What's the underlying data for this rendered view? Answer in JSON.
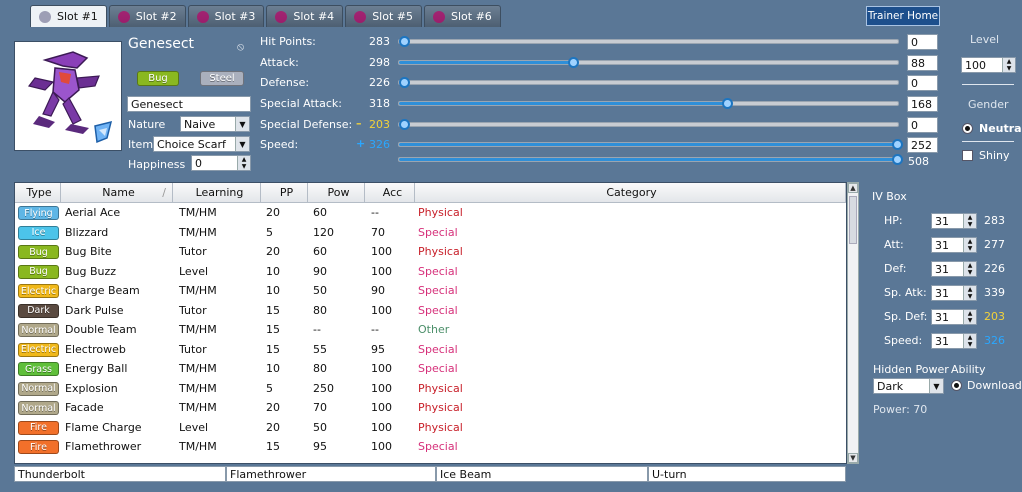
{
  "colors": {
    "background": "#5a7796",
    "slider": "#2f8fd8",
    "stat_up": "#2aa7ff",
    "stat_down": "#f2d23a",
    "physical": "#c8202a",
    "special": "#d6307a",
    "other": "#4c8f6a"
  },
  "tabs": [
    {
      "label": "Slot #1",
      "icon": "genesect-icon",
      "active": true
    },
    {
      "label": "Slot #2",
      "icon": "pokemon-icon",
      "active": false
    },
    {
      "label": "Slot #3",
      "icon": "pokemon-icon",
      "active": false
    },
    {
      "label": "Slot #4",
      "icon": "pokemon-icon",
      "active": false
    },
    {
      "label": "Slot #5",
      "icon": "pokemon-icon",
      "active": false
    },
    {
      "label": "Slot #6",
      "icon": "pokemon-icon",
      "active": false
    }
  ],
  "trainer_home": "Trainer Home",
  "pokemon": {
    "species": "Genesect",
    "gender_symbol": "⦸",
    "types": [
      {
        "name": "Bug",
        "color": "#8ab820"
      },
      {
        "name": "Steel",
        "color": "#aab0bd"
      }
    ],
    "nickname": "Genesect",
    "nature_label": "Nature",
    "nature": "Naive",
    "item_label": "Item",
    "item": "Choice Scarf",
    "happiness_label": "Happiness",
    "happiness": "0"
  },
  "stats": [
    {
      "label": "Hit Points:",
      "value": "283",
      "ev": "0",
      "ev_fraction": 0.0,
      "modifier": "",
      "value_color": "#ffffff"
    },
    {
      "label": "Attack:",
      "value": "298",
      "ev": "88",
      "ev_fraction": 0.35,
      "modifier": "",
      "value_color": "#ffffff"
    },
    {
      "label": "Defense:",
      "value": "226",
      "ev": "0",
      "ev_fraction": 0.0,
      "modifier": "",
      "value_color": "#ffffff"
    },
    {
      "label": "Special Attack:",
      "value": "318",
      "ev": "168",
      "ev_fraction": 0.66,
      "modifier": "",
      "value_color": "#ffffff"
    },
    {
      "label": "Special Defense:",
      "value": "203",
      "ev": "0",
      "ev_fraction": 0.0,
      "modifier": "–",
      "value_color": "#f2d23a"
    },
    {
      "label": "Speed:",
      "value": "326",
      "ev": "252",
      "ev_fraction": 1.0,
      "modifier": "+",
      "value_color": "#2aa7ff"
    }
  ],
  "ev_total": {
    "value": "508",
    "fraction": 1.0
  },
  "level": {
    "label": "Level",
    "value": "100"
  },
  "gender": {
    "label": "Gender",
    "option": "Neutral",
    "shiny_label": "Shiny"
  },
  "moves_table": {
    "columns": [
      "Type",
      "Name",
      "Learning",
      "PP",
      "Pow",
      "Acc",
      "Category"
    ],
    "rows": [
      {
        "type": "Flying",
        "type_color": "#5fb6e6",
        "name": "Aerial Ace",
        "learning": "TM/HM",
        "pp": "20",
        "pow": "60",
        "acc": "--",
        "category": "Physical"
      },
      {
        "type": "Ice",
        "type_color": "#4cc4ea",
        "name": "Blizzard",
        "learning": "TM/HM",
        "pp": "5",
        "pow": "120",
        "acc": "70",
        "category": "Special"
      },
      {
        "type": "Bug",
        "type_color": "#8ab820",
        "name": "Bug Bite",
        "learning": "Tutor",
        "pp": "20",
        "pow": "60",
        "acc": "100",
        "category": "Physical"
      },
      {
        "type": "Bug",
        "type_color": "#8ab820",
        "name": "Bug Buzz",
        "learning": "Level",
        "pp": "10",
        "pow": "90",
        "acc": "100",
        "category": "Special"
      },
      {
        "type": "Electric",
        "type_color": "#f0b81a",
        "name": "Charge Beam",
        "learning": "TM/HM",
        "pp": "10",
        "pow": "50",
        "acc": "90",
        "category": "Special"
      },
      {
        "type": "Dark",
        "type_color": "#5a4a40",
        "name": "Dark Pulse",
        "learning": "Tutor",
        "pp": "15",
        "pow": "80",
        "acc": "100",
        "category": "Special"
      },
      {
        "type": "Normal",
        "type_color": "#b0a88a",
        "name": "Double Team",
        "learning": "TM/HM",
        "pp": "15",
        "pow": "--",
        "acc": "--",
        "category": "Other"
      },
      {
        "type": "Electric",
        "type_color": "#f0b81a",
        "name": "Electroweb",
        "learning": "Tutor",
        "pp": "15",
        "pow": "55",
        "acc": "95",
        "category": "Special"
      },
      {
        "type": "Grass",
        "type_color": "#5fbf3a",
        "name": "Energy Ball",
        "learning": "TM/HM",
        "pp": "10",
        "pow": "80",
        "acc": "100",
        "category": "Special"
      },
      {
        "type": "Normal",
        "type_color": "#b0a88a",
        "name": "Explosion",
        "learning": "TM/HM",
        "pp": "5",
        "pow": "250",
        "acc": "100",
        "category": "Physical"
      },
      {
        "type": "Normal",
        "type_color": "#b0a88a",
        "name": "Facade",
        "learning": "TM/HM",
        "pp": "20",
        "pow": "70",
        "acc": "100",
        "category": "Physical"
      },
      {
        "type": "Fire",
        "type_color": "#f2702a",
        "name": "Flame Charge",
        "learning": "Level",
        "pp": "20",
        "pow": "50",
        "acc": "100",
        "category": "Physical"
      },
      {
        "type": "Fire",
        "type_color": "#f2702a",
        "name": "Flamethrower",
        "learning": "TM/HM",
        "pp": "15",
        "pow": "95",
        "acc": "100",
        "category": "Special"
      }
    ]
  },
  "selected_moves": [
    "Thunderbolt",
    "Flamethrower",
    "Ice Beam",
    "U-turn"
  ],
  "iv_box": {
    "title": "IV Box",
    "rows": [
      {
        "label": "HP:",
        "iv": "31",
        "stat": "283",
        "color": "#ffffff"
      },
      {
        "label": "Att:",
        "iv": "31",
        "stat": "277",
        "color": "#ffffff"
      },
      {
        "label": "Def:",
        "iv": "31",
        "stat": "226",
        "color": "#ffffff"
      },
      {
        "label": "Sp. Atk:",
        "iv": "31",
        "stat": "339",
        "color": "#ffffff"
      },
      {
        "label": "Sp. Def:",
        "iv": "31",
        "stat": "203",
        "color": "#f2d23a"
      },
      {
        "label": "Speed:",
        "iv": "31",
        "stat": "326",
        "color": "#2aa7ff"
      }
    ]
  },
  "hidden_power": {
    "label": "Hidden Power",
    "type": "Dark",
    "power_text": "Power: 70"
  },
  "ability": {
    "label": "Ability",
    "value": "Download"
  }
}
